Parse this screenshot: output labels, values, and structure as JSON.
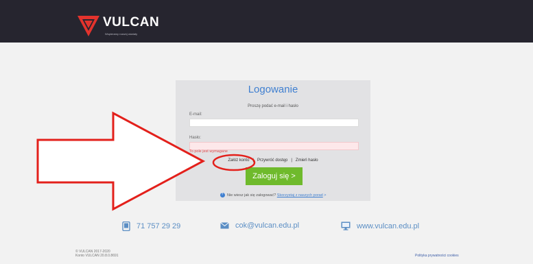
{
  "brand": {
    "name": "VULCAN",
    "tagline": "Wspieramy rozwój oświaty",
    "colors": {
      "red": "#e3332d",
      "dark": "#26252f"
    }
  },
  "login": {
    "title": "Logowanie",
    "subtitle": "Proszę podać e-mail i hasło",
    "email_label": "E-mail:",
    "email_value": "",
    "password_label": "Hasło:",
    "password_value": "",
    "error": "To pole jest wymagane",
    "link_create": "Załóż konto",
    "link_restore": "Przywróć dostęp",
    "link_change": "Zmień hasło",
    "separator": "|",
    "submit_label": "Zaloguj się >",
    "help_icon": "?",
    "help_prefix": "Nie wiesz jak się zalogować?",
    "help_link": "Skorzystaj z naszych porad",
    "help_arrow": ">",
    "accent": "#3f7fd0",
    "button_color": "#6fba2c"
  },
  "contact": {
    "phone": "71 757 29 29",
    "email": "cok@vulcan.edu.pl",
    "website": "www.vulcan.edu.pl",
    "icons": [
      "phone-icon",
      "mail-icon",
      "monitor-icon"
    ]
  },
  "footer": {
    "copyright": "© VULCAN 2017-2020",
    "version": "Konto VULCAN 20.8.0.8691",
    "privacy": "Polityka prywatności cookies"
  },
  "annotations": {
    "color": "#e3201b",
    "items": [
      "red-arrow",
      "red-ellipse"
    ]
  }
}
